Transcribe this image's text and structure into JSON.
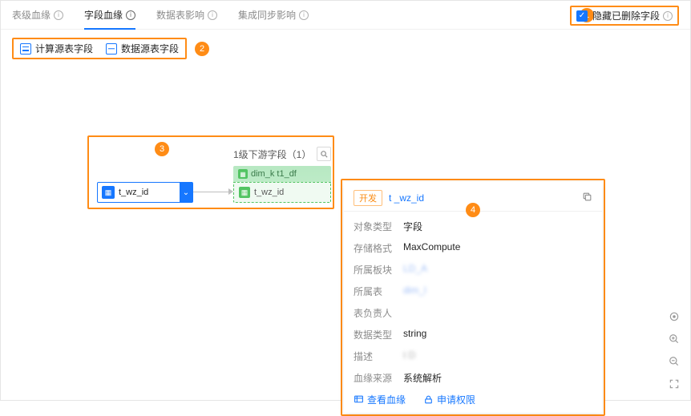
{
  "tabs": {
    "table_lineage": "表级血缘",
    "field_lineage": "字段血缘",
    "data_impact": "数据表影响",
    "sync_impact": "集成同步影响"
  },
  "top_right": {
    "checkbox_label": "隐藏已删除字段"
  },
  "legend": {
    "calc_source": "计算源表字段",
    "data_source": "数据源表字段"
  },
  "markers": {
    "m1": "1",
    "m2": "2",
    "m3": "3",
    "m4": "4"
  },
  "canvas": {
    "downstream_label": "1级下游字段（1）",
    "table_node": "dim_k            t1_df",
    "target_field": "     t_wz_id",
    "source_field": "     t_wz_id"
  },
  "detail": {
    "tag": "开发",
    "id": "t     _wz_id",
    "rows": {
      "obj_type_k": "对象类型",
      "obj_type_v": "字段",
      "storage_k": "存储格式",
      "storage_v": "MaxCompute",
      "module_k": "所属板块",
      "module_v": "LD_A          ",
      "table_k": "所属表",
      "table_v": "dim_l                         ",
      "owner_k": "表负责人",
      "owner_v": "            ",
      "dtype_k": "数据类型",
      "dtype_v": "string",
      "desc_k": "描述",
      "desc_v": "t        D",
      "source_k": "血缘来源",
      "source_v": "系统解析"
    },
    "actions": {
      "view": "查看血缘",
      "apply": "申请权限"
    }
  }
}
